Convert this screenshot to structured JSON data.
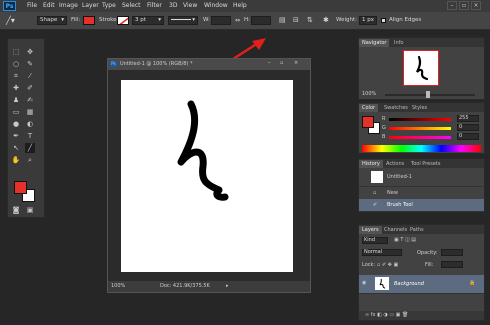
{
  "app": {
    "logo": "Ps"
  },
  "menu": [
    "File",
    "Edit",
    "Image",
    "Layer",
    "Type",
    "Select",
    "Filter",
    "3D",
    "View",
    "Window",
    "Help"
  ],
  "window_controls": [
    "–",
    "▫",
    "×"
  ],
  "options": {
    "tool_mode": "Shape",
    "fill_label": "Fill:",
    "stroke_label": "Stroke:",
    "stroke_width": "3 pt",
    "w_label": "W:",
    "h_label": "H:",
    "weight_label": "Weight:",
    "weight_value": "1 px",
    "align_edges_label": "Align Edges"
  },
  "document": {
    "title": "Untitled-1 @ 100% (RGB/8) *",
    "zoom": "100%",
    "doc_info": "Doc: 421.9K/375.5K"
  },
  "navigator": {
    "tabs": [
      "Navigator",
      "Info"
    ],
    "zoom": "100%"
  },
  "color": {
    "tabs": [
      "Color",
      "Swatches",
      "Styles"
    ],
    "r": "255",
    "g": "0",
    "b": "0"
  },
  "history": {
    "tabs": [
      "History",
      "Actions",
      "Tool Presets"
    ],
    "snapshot": "Untitled-1",
    "items": [
      "New",
      "Brush Tool"
    ]
  },
  "layers": {
    "tabs": [
      "Layers",
      "Channels",
      "Paths"
    ],
    "kind_label": "Kind",
    "blend_mode": "Normal",
    "opacity_label": "Opacity:",
    "lock_label": "Lock:",
    "fill_label": "Fill:",
    "layer_name": "Background"
  },
  "colors": {
    "accent": "#e8302a",
    "foreground": "#e8302a",
    "background": "#ffffff",
    "arrow": "#e0201c"
  }
}
